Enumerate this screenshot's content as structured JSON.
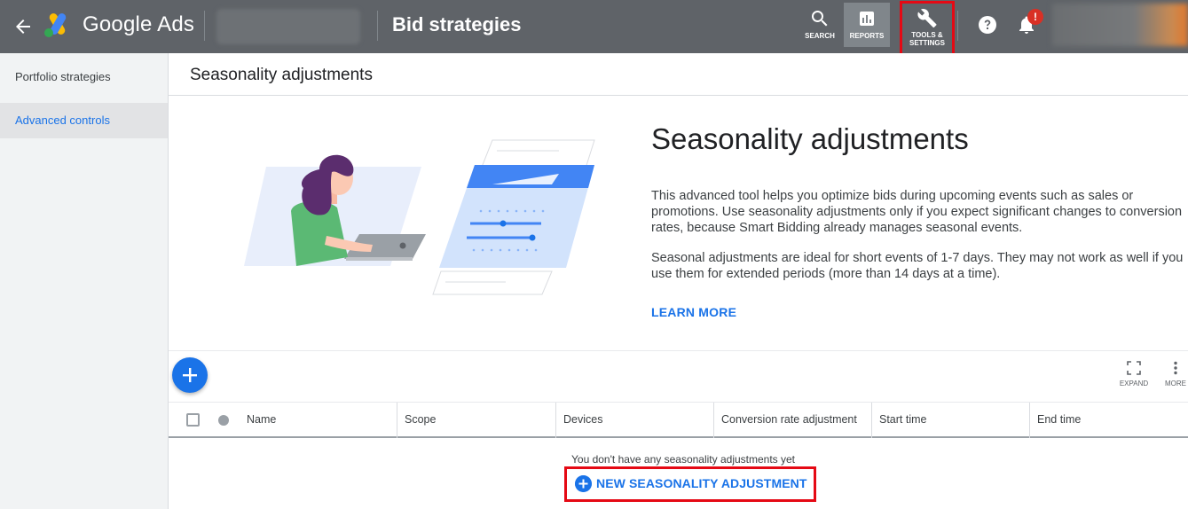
{
  "topbar": {
    "brand": "Google Ads",
    "page_title": "Bid strategies",
    "search_label": "SEARCH",
    "reports_label": "REPORTS",
    "tools_label_line1": "TOOLS &",
    "tools_label_line2": "SETTINGS",
    "notification_badge": "!"
  },
  "sidebar": {
    "items": [
      {
        "label": "Portfolio strategies"
      },
      {
        "label": "Advanced controls"
      }
    ]
  },
  "main": {
    "title": "Seasonality adjustments",
    "hero": {
      "title": "Seasonality adjustments",
      "paragraph1": "This advanced tool helps you optimize bids during upcoming events such as sales or promotions. Use seasonality adjustments only if you expect significant changes to conversion rates, because Smart Bidding already manages seasonal events.",
      "paragraph2": "Seasonal adjustments are ideal for short events of 1-7 days. They may not work as well if you use them for extended periods (more than 14 days at a time).",
      "learn_more": "LEARN MORE"
    },
    "toolbar": {
      "expand_label": "EXPAND",
      "more_label": "MORE"
    },
    "table": {
      "columns": [
        "Name",
        "Scope",
        "Devices",
        "Conversion rate adjustment",
        "Start time",
        "End time"
      ],
      "empty_message": "You don't have any seasonality adjustments yet",
      "new_button": "NEW SEASONALITY ADJUSTMENT"
    }
  },
  "colors": {
    "topbar": "#5f6368",
    "accent": "#1a73e8",
    "highlight": "#e50914",
    "badge": "#d93025"
  }
}
